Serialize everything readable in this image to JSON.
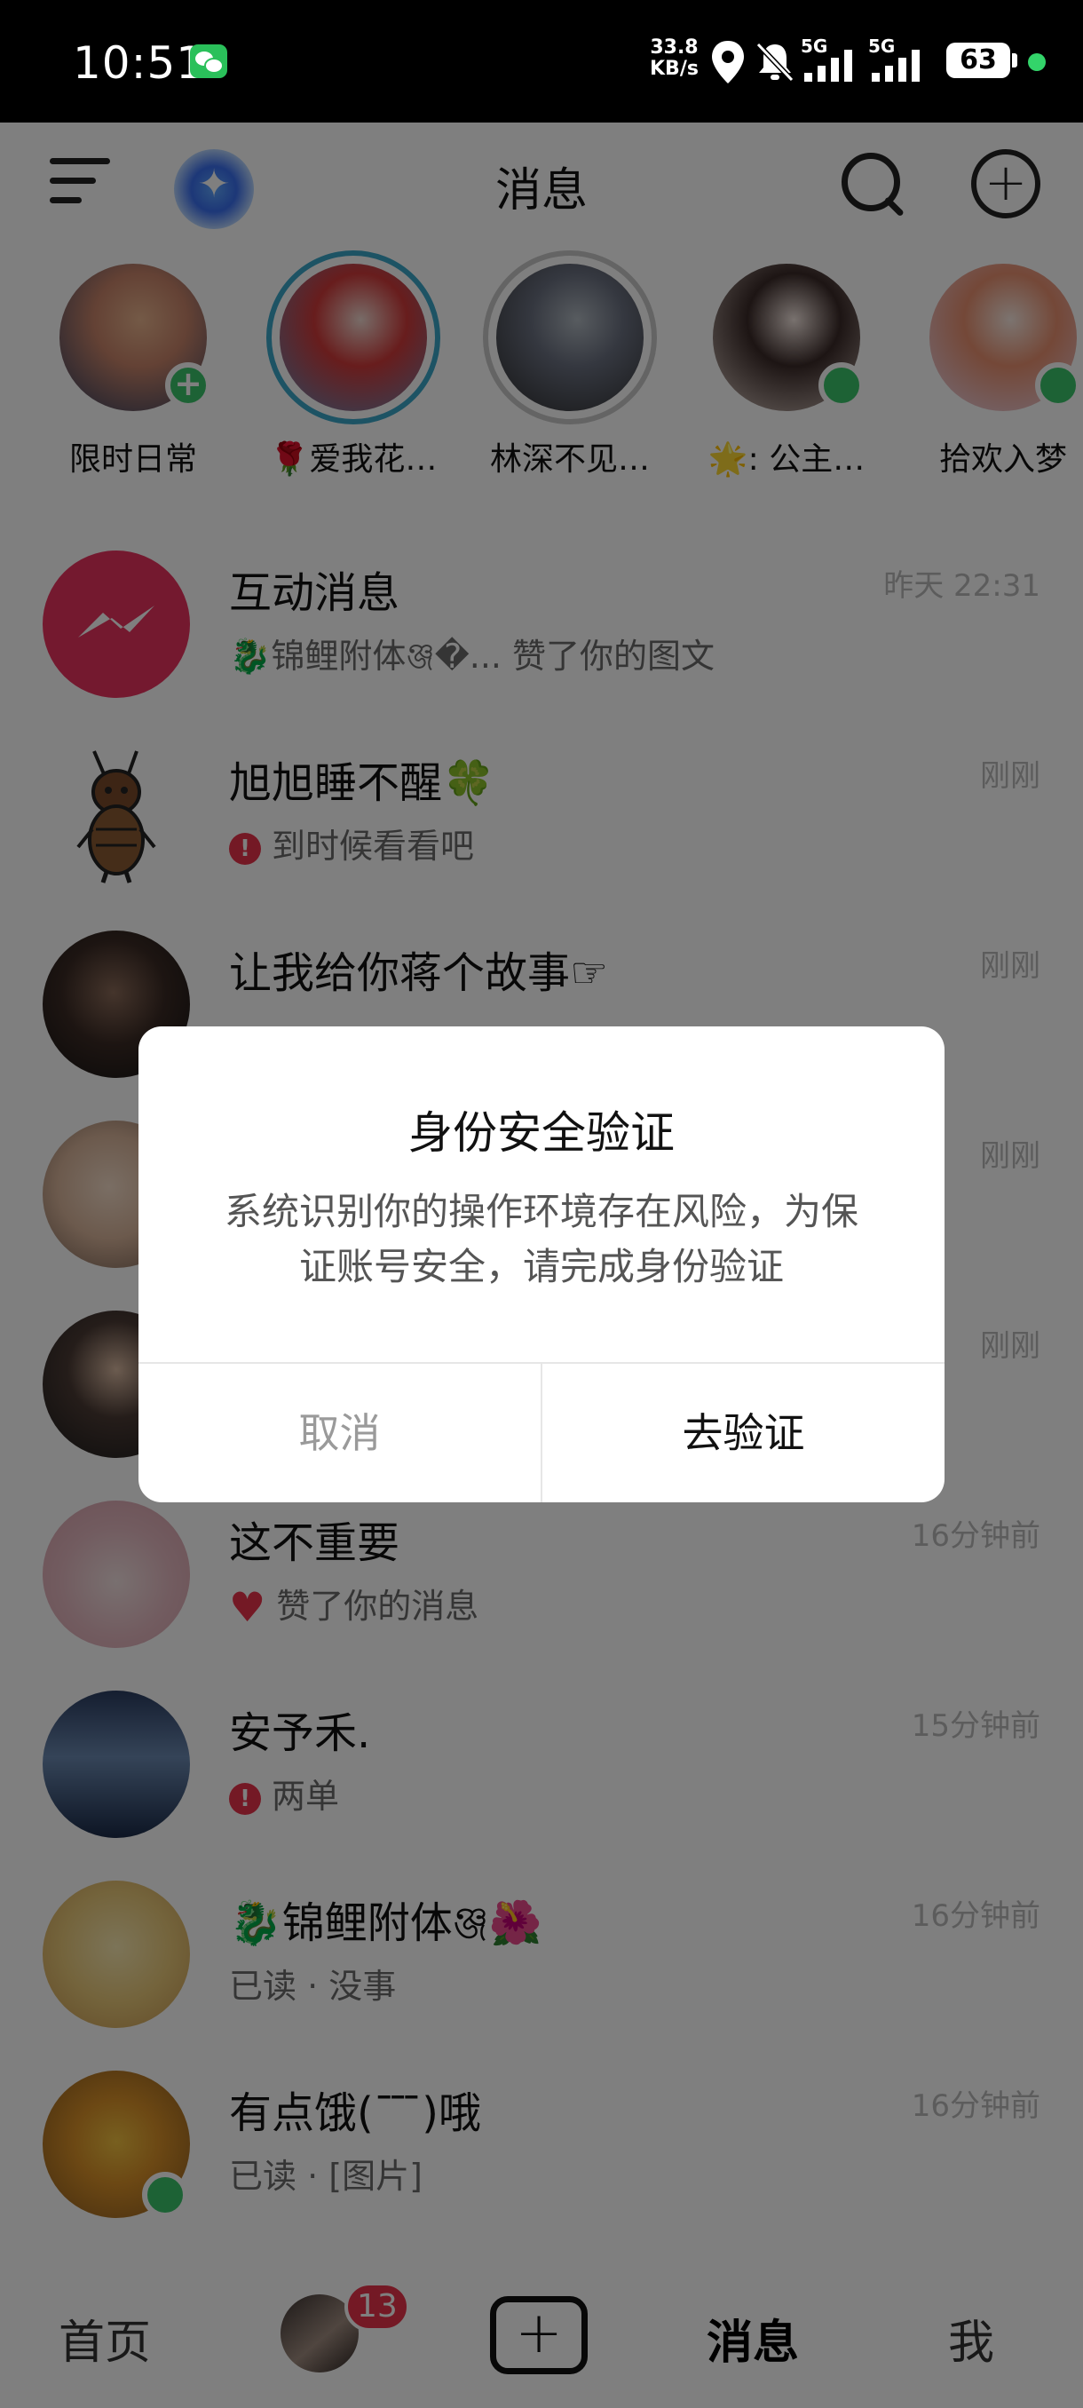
{
  "status_bar": {
    "time": "10:51",
    "net_speed_value": "33.8",
    "net_speed_unit": "KB/s",
    "signal_label_1": "5G",
    "signal_label_2": "5G",
    "battery": "63",
    "icons": [
      "wechat-icon",
      "location-icon",
      "mute-bell-icon",
      "signal-icon",
      "battery-icon"
    ]
  },
  "header": {
    "title": "消息",
    "icons": [
      "menu-icon",
      "ai-assistant-icon",
      "search-icon",
      "add-icon"
    ]
  },
  "stories": [
    {
      "label": "限时日常",
      "badge": "plus",
      "ring": "none",
      "avatar_colors": [
        "#2a3a5c",
        "#c8846a",
        "#e8b48e"
      ]
    },
    {
      "label": "🌹爱我花…",
      "badge": "none",
      "ring": "#3aa6c8",
      "avatar_colors": [
        "#5a8ab8",
        "#d03a3a",
        "#f0d8d0"
      ]
    },
    {
      "label": "林深不见…",
      "badge": "none",
      "ring": "#c8c8c8",
      "avatar_colors": [
        "#2a2a2a",
        "#6a7080",
        "#b0b8c0"
      ]
    },
    {
      "label": "🌟: 公主…",
      "badge": "online",
      "ring": "none",
      "avatar_colors": [
        "#d8c8c0",
        "#3a2a28",
        "#f2e4de"
      ]
    },
    {
      "label": "拾欢入梦",
      "badge": "online",
      "ring": "none",
      "avatar_colors": [
        "#e8d8f0",
        "#e89070",
        "#f8e8e0"
      ]
    }
  ],
  "messages": [
    {
      "name": "互动消息",
      "preview": "🐉锦鲤附体ঞ্জ�... 赞了你的图文",
      "time": "昨天 22:31",
      "prefix": "",
      "avatar": "interaction",
      "online": false
    },
    {
      "name": "旭旭睡不醒🍀",
      "preview": "到时候看看吧",
      "time": "刚刚",
      "prefix": "warn",
      "avatar": "bug",
      "online": false
    },
    {
      "name": "让我给你蒋个故事☞",
      "preview": "",
      "time": "刚刚",
      "prefix": "",
      "avatar": "dark",
      "online": false
    },
    {
      "name": "",
      "preview": "",
      "time": "刚刚",
      "prefix": "",
      "avatar": "face",
      "online": false
    },
    {
      "name": "",
      "preview": "",
      "time": "刚刚",
      "prefix": "",
      "avatar": "man",
      "online": false
    },
    {
      "name": "这不重要",
      "preview": "赞了你的消息",
      "time": "16分钟前",
      "prefix": "heart",
      "avatar": "anime",
      "online": false
    },
    {
      "name": "安予禾.",
      "preview": "两单",
      "time": "15分钟前",
      "prefix": "warn",
      "avatar": "sea",
      "online": false
    },
    {
      "name": "🐉锦鲤附体ঞ্জ🌺",
      "preview": "已读 · 没事",
      "time": "16分钟前",
      "prefix": "",
      "avatar": "cartoon",
      "online": false
    },
    {
      "name": "有点饿(¯ ̄ ̄)哦",
      "preview": "已读 · [图片]",
      "time": "16分钟前",
      "prefix": "",
      "avatar": "tart",
      "online": true
    }
  ],
  "bottom_nav": {
    "home": "首页",
    "messages_badge": "13",
    "messages": "消息",
    "me": "我"
  },
  "dialog": {
    "title": "身份安全验证",
    "body_line1": "系统识别你的操作环境存在风险，为保",
    "body_line2": "证账号安全，请完成身份验证",
    "cancel": "取消",
    "confirm": "去验证"
  },
  "colors": {
    "accent_red": "#e8334a",
    "online_green": "#3bc56a",
    "overlay": "rgba(0,0,0,0.5)"
  }
}
